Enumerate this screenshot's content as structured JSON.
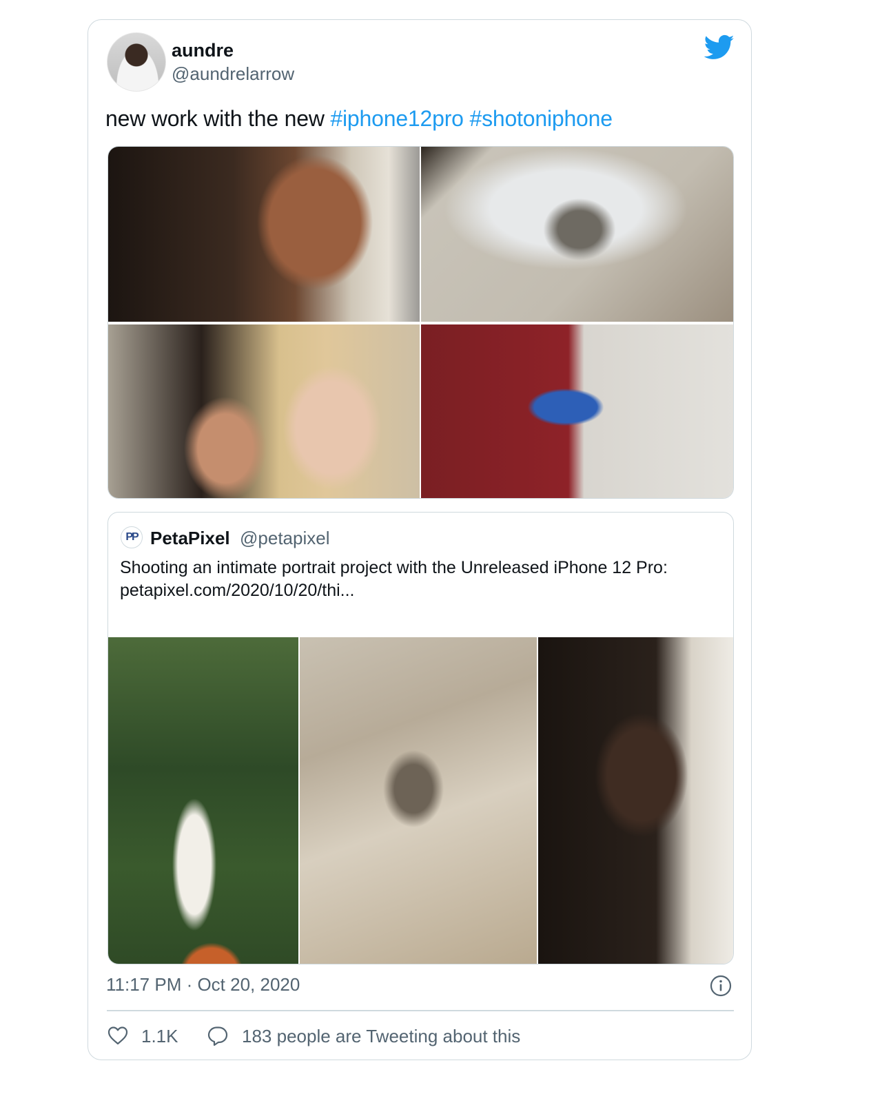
{
  "tweet": {
    "author": {
      "display_name": "aundre",
      "handle": "@aundrelarrow"
    },
    "text_plain": "new work with the new ",
    "hashtags": [
      "#iphone12pro",
      "#shotoniphone"
    ],
    "timestamp": "11:17 PM · Oct 20, 2020",
    "likes": "1.1K",
    "tweeting_text": "183 people are Tweeting about this"
  },
  "quoted_tweet": {
    "author": {
      "display_name": "PetaPixel",
      "handle": "@petapixel",
      "avatar_text": "PP"
    },
    "text": "Shooting an intimate portrait project with the Unreleased iPhone 12 Pro:",
    "link": "petapixel.com/2020/10/20/thi..."
  },
  "icons": {
    "brand": "twitter-bird-icon",
    "info": "info-icon",
    "like": "heart-icon",
    "conversation": "speech-bubble-icon"
  },
  "colors": {
    "brand_blue": "#1d9bf0",
    "hashtag": "#1d9bf0",
    "secondary_text": "#536471",
    "border": "#cfd9de"
  }
}
